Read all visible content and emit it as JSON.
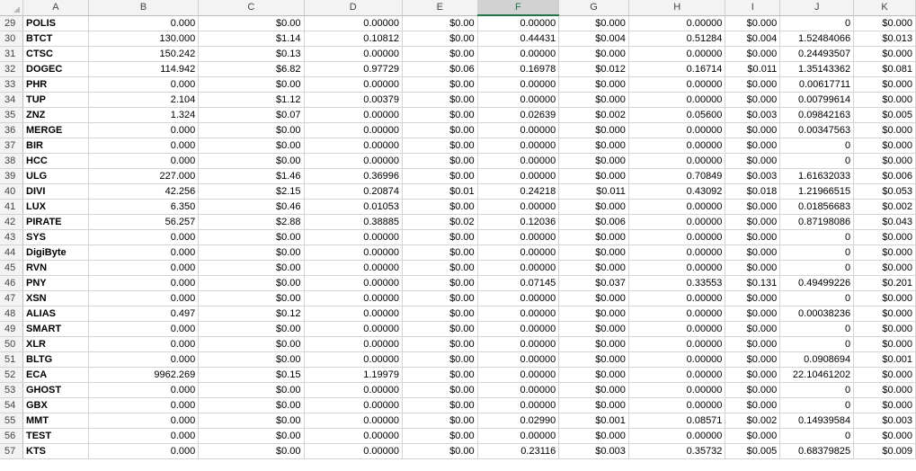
{
  "columns": [
    "A",
    "B",
    "C",
    "D",
    "E",
    "F",
    "G",
    "H",
    "I",
    "J",
    "K"
  ],
  "selected_column": "F",
  "rows": [
    {
      "n": "29",
      "cells": [
        "POLIS",
        "0.000",
        "$0.00",
        "0.00000",
        "$0.00",
        "0.00000",
        "$0.000",
        "0.00000",
        "$0.000",
        "0",
        "$0.000"
      ]
    },
    {
      "n": "30",
      "cells": [
        "BTCT",
        "130.000",
        "$1.14",
        "0.10812",
        "$0.00",
        "0.44431",
        "$0.004",
        "0.51284",
        "$0.004",
        "1.52484066",
        "$0.013"
      ]
    },
    {
      "n": "31",
      "cells": [
        "CTSC",
        "150.242",
        "$0.13",
        "0.00000",
        "$0.00",
        "0.00000",
        "$0.000",
        "0.00000",
        "$0.000",
        "0.24493507",
        "$0.000"
      ]
    },
    {
      "n": "32",
      "cells": [
        "DOGEC",
        "114.942",
        "$6.82",
        "0.97729",
        "$0.06",
        "0.16978",
        "$0.012",
        "0.16714",
        "$0.011",
        "1.35143362",
        "$0.081"
      ]
    },
    {
      "n": "33",
      "cells": [
        "PHR",
        "0.000",
        "$0.00",
        "0.00000",
        "$0.00",
        "0.00000",
        "$0.000",
        "0.00000",
        "$0.000",
        "0.00617711",
        "$0.000"
      ]
    },
    {
      "n": "34",
      "cells": [
        "TUP",
        "2.104",
        "$1.12",
        "0.00379",
        "$0.00",
        "0.00000",
        "$0.000",
        "0.00000",
        "$0.000",
        "0.00799614",
        "$0.000"
      ]
    },
    {
      "n": "35",
      "cells": [
        "ZNZ",
        "1.324",
        "$0.07",
        "0.00000",
        "$0.00",
        "0.02639",
        "$0.002",
        "0.05600",
        "$0.003",
        "0.09842163",
        "$0.005"
      ]
    },
    {
      "n": "36",
      "cells": [
        "MERGE",
        "0.000",
        "$0.00",
        "0.00000",
        "$0.00",
        "0.00000",
        "$0.000",
        "0.00000",
        "$0.000",
        "0.00347563",
        "$0.000"
      ]
    },
    {
      "n": "37",
      "cells": [
        "BIR",
        "0.000",
        "$0.00",
        "0.00000",
        "$0.00",
        "0.00000",
        "$0.000",
        "0.00000",
        "$0.000",
        "0",
        "$0.000"
      ]
    },
    {
      "n": "38",
      "cells": [
        "HCC",
        "0.000",
        "$0.00",
        "0.00000",
        "$0.00",
        "0.00000",
        "$0.000",
        "0.00000",
        "$0.000",
        "0",
        "$0.000"
      ]
    },
    {
      "n": "39",
      "cells": [
        "ULG",
        "227.000",
        "$1.46",
        "0.36996",
        "$0.00",
        "0.00000",
        "$0.000",
        "0.70849",
        "$0.003",
        "1.61632033",
        "$0.006"
      ]
    },
    {
      "n": "40",
      "cells": [
        "DIVI",
        "42.256",
        "$2.15",
        "0.20874",
        "$0.01",
        "0.24218",
        "$0.011",
        "0.43092",
        "$0.018",
        "1.21966515",
        "$0.053"
      ]
    },
    {
      "n": "41",
      "cells": [
        "LUX",
        "6.350",
        "$0.46",
        "0.01053",
        "$0.00",
        "0.00000",
        "$0.000",
        "0.00000",
        "$0.000",
        "0.01856683",
        "$0.002"
      ]
    },
    {
      "n": "42",
      "cells": [
        "PIRATE",
        "56.257",
        "$2.88",
        "0.38885",
        "$0.02",
        "0.12036",
        "$0.006",
        "0.00000",
        "$0.000",
        "0.87198086",
        "$0.043"
      ]
    },
    {
      "n": "43",
      "cells": [
        "SYS",
        "0.000",
        "$0.00",
        "0.00000",
        "$0.00",
        "0.00000",
        "$0.000",
        "0.00000",
        "$0.000",
        "0",
        "$0.000"
      ]
    },
    {
      "n": "44",
      "cells": [
        "DigiByte",
        "0.000",
        "$0.00",
        "0.00000",
        "$0.00",
        "0.00000",
        "$0.000",
        "0.00000",
        "$0.000",
        "0",
        "$0.000"
      ]
    },
    {
      "n": "45",
      "cells": [
        "RVN",
        "0.000",
        "$0.00",
        "0.00000",
        "$0.00",
        "0.00000",
        "$0.000",
        "0.00000",
        "$0.000",
        "0",
        "$0.000"
      ]
    },
    {
      "n": "46",
      "cells": [
        "PNY",
        "0.000",
        "$0.00",
        "0.00000",
        "$0.00",
        "0.07145",
        "$0.037",
        "0.33553",
        "$0.131",
        "0.49499226",
        "$0.201"
      ]
    },
    {
      "n": "47",
      "cells": [
        "XSN",
        "0.000",
        "$0.00",
        "0.00000",
        "$0.00",
        "0.00000",
        "$0.000",
        "0.00000",
        "$0.000",
        "0",
        "$0.000"
      ]
    },
    {
      "n": "48",
      "cells": [
        "ALIAS",
        "0.497",
        "$0.12",
        "0.00000",
        "$0.00",
        "0.00000",
        "$0.000",
        "0.00000",
        "$0.000",
        "0.00038236",
        "$0.000"
      ]
    },
    {
      "n": "49",
      "cells": [
        "SMART",
        "0.000",
        "$0.00",
        "0.00000",
        "$0.00",
        "0.00000",
        "$0.000",
        "0.00000",
        "$0.000",
        "0",
        "$0.000"
      ]
    },
    {
      "n": "50",
      "cells": [
        "XLR",
        "0.000",
        "$0.00",
        "0.00000",
        "$0.00",
        "0.00000",
        "$0.000",
        "0.00000",
        "$0.000",
        "0",
        "$0.000"
      ]
    },
    {
      "n": "51",
      "cells": [
        "BLTG",
        "0.000",
        "$0.00",
        "0.00000",
        "$0.00",
        "0.00000",
        "$0.000",
        "0.00000",
        "$0.000",
        "0.0908694",
        "$0.001"
      ]
    },
    {
      "n": "52",
      "cells": [
        "ECA",
        "9962.269",
        "$0.15",
        "1.19979",
        "$0.00",
        "0.00000",
        "$0.000",
        "0.00000",
        "$0.000",
        "22.10461202",
        "$0.000"
      ]
    },
    {
      "n": "53",
      "cells": [
        "GHOST",
        "0.000",
        "$0.00",
        "0.00000",
        "$0.00",
        "0.00000",
        "$0.000",
        "0.00000",
        "$0.000",
        "0",
        "$0.000"
      ]
    },
    {
      "n": "54",
      "cells": [
        "GBX",
        "0.000",
        "$0.00",
        "0.00000",
        "$0.00",
        "0.00000",
        "$0.000",
        "0.00000",
        "$0.000",
        "0",
        "$0.000"
      ]
    },
    {
      "n": "55",
      "cells": [
        "MMT",
        "0.000",
        "$0.00",
        "0.00000",
        "$0.00",
        "0.02990",
        "$0.001",
        "0.08571",
        "$0.002",
        "0.14939584",
        "$0.003"
      ]
    },
    {
      "n": "56",
      "cells": [
        "TEST",
        "0.000",
        "$0.00",
        "0.00000",
        "$0.00",
        "0.00000",
        "$0.000",
        "0.00000",
        "$0.000",
        "0",
        "$0.000"
      ]
    },
    {
      "n": "57",
      "cells": [
        "KTS",
        "0.000",
        "$0.00",
        "0.00000",
        "$0.00",
        "0.23116",
        "$0.003",
        "0.35732",
        "$0.005",
        "0.68379825",
        "$0.009"
      ]
    }
  ]
}
